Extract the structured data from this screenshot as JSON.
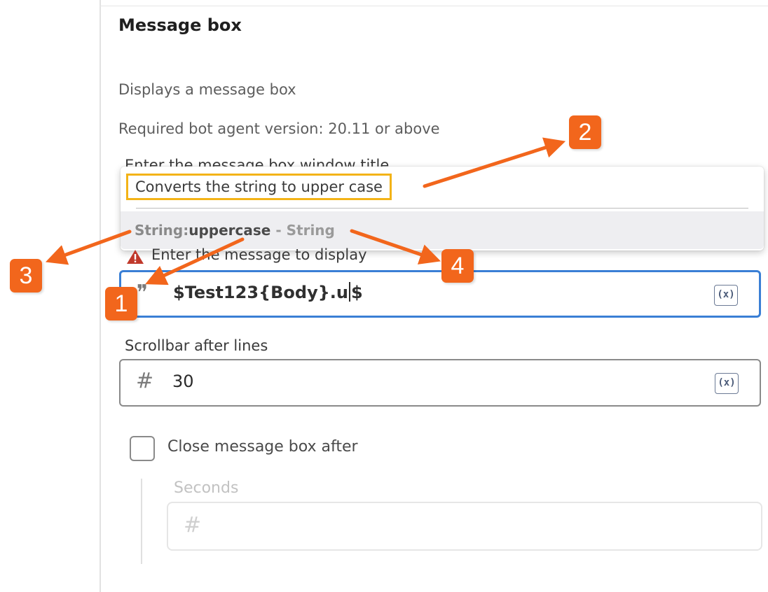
{
  "panel": {
    "title": "Message box",
    "description": "Displays a message box",
    "required_version": "Required bot agent version: 20.11 or above",
    "title_field_label_partial": "Enter the message box window title"
  },
  "autocomplete": {
    "tooltip": "Converts the string to upper case",
    "item_namespace": "String:",
    "item_function": "uppercase",
    "item_separator": " - ",
    "item_type": "String"
  },
  "message_field": {
    "label": "Enter the message to display",
    "leading_icon": "quote-icon",
    "value_before_caret": "$Test123{Body}.u",
    "value_after_caret": "$",
    "variable_button": "(x)"
  },
  "scrollbar_field": {
    "label": "Scrollbar after lines",
    "leading_icon": "hash-icon",
    "value": "30",
    "variable_button": "(x)"
  },
  "close_after": {
    "label": "Close message box after",
    "checked": false,
    "seconds_label": "Seconds",
    "seconds_icon": "hash-icon",
    "seconds_value": ""
  },
  "callouts": [
    {
      "number": "1"
    },
    {
      "number": "2"
    },
    {
      "number": "3"
    },
    {
      "number": "4"
    }
  ],
  "colors": {
    "callout": "#f2661c",
    "focus_border": "#3a7fd5",
    "tooltip_highlight": "#f3b317",
    "warning": "#c0392b"
  }
}
